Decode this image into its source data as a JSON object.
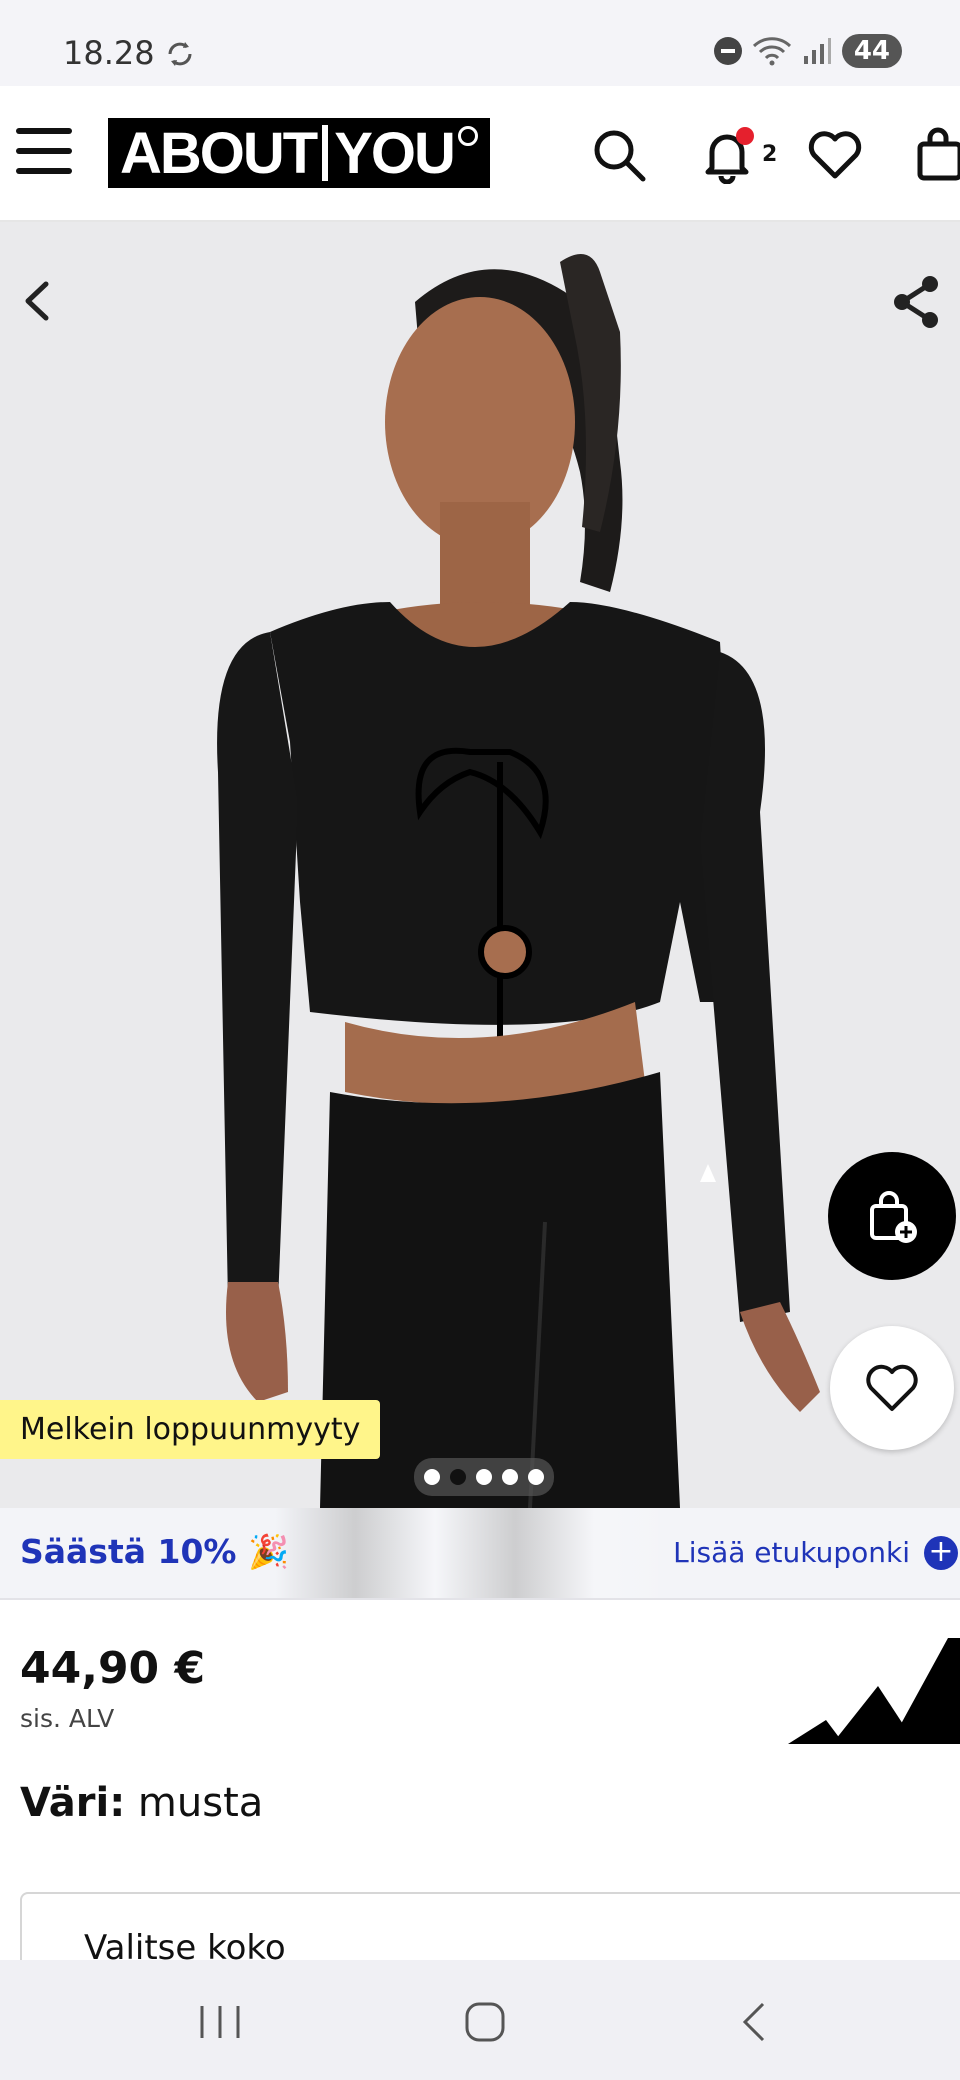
{
  "status_bar": {
    "time": "18.28",
    "battery": "44"
  },
  "header": {
    "logo_text_left": "ABOUT",
    "logo_text_right": "YOU",
    "notification_count": "2"
  },
  "hero": {
    "badge": "Melkein loppuunmyyty",
    "carousel": {
      "total": 5,
      "active_index": 1
    }
  },
  "coupon": {
    "left_text": "Säästä 10% 🎉",
    "right_text": "Lisää etukuponki",
    "plus": "+"
  },
  "product": {
    "price": "44,90 €",
    "vat_note": "sis. ALV",
    "color_label": "Väri:",
    "color_value": "musta",
    "size_select_label": "Valitse koko"
  },
  "colors": {
    "accent": "#1f34b8",
    "badge_bg": "#fff58a",
    "notification_dot": "#e5202d"
  },
  "icons": [
    "menu-icon",
    "search-icon",
    "bell-icon",
    "heart-icon",
    "bag-icon",
    "back-icon",
    "share-icon",
    "bag-add-icon",
    "adidas-logo"
  ]
}
